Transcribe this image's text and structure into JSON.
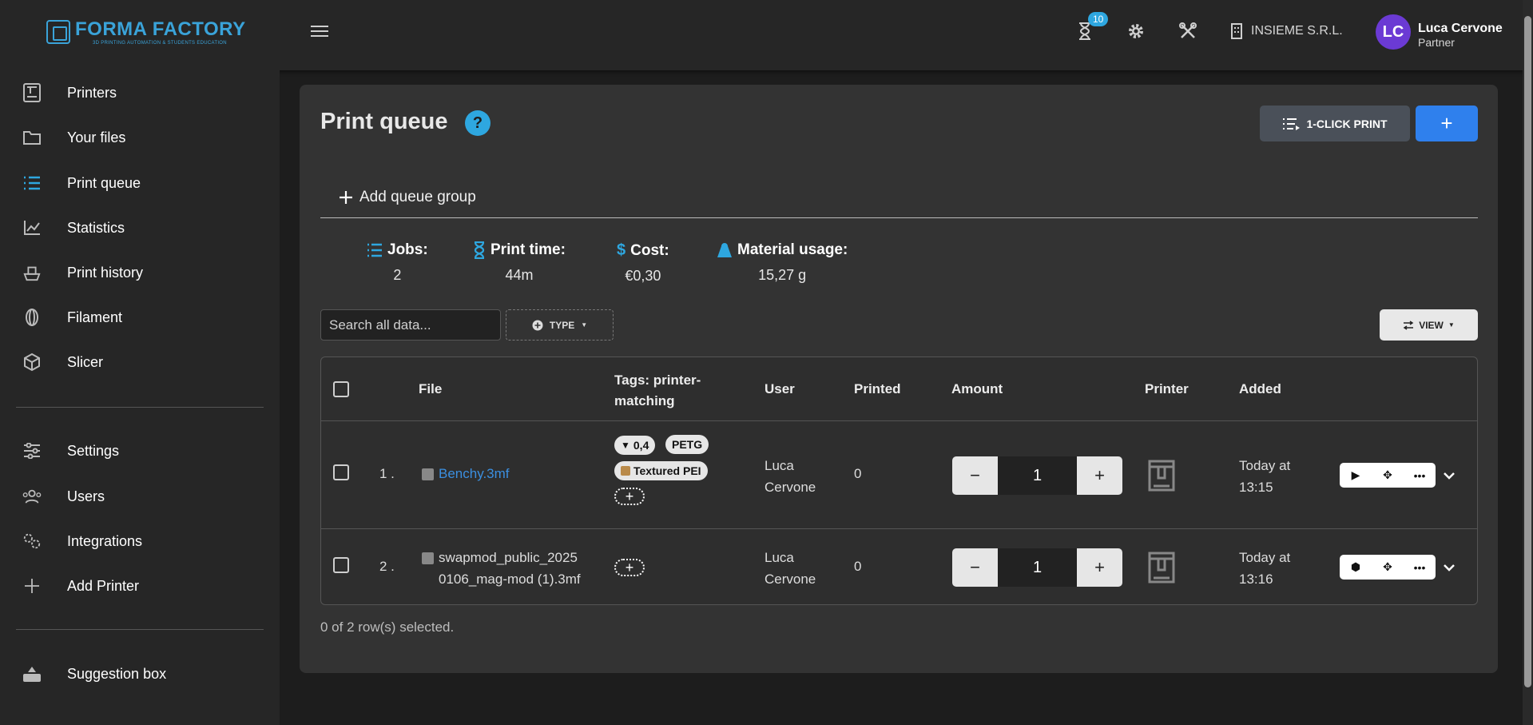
{
  "header": {
    "logo_title": "FORMA FACTORY",
    "logo_subtitle": "3D PRINTING AUTOMATION & STUDENTS EDUCATION",
    "queue_badge": "10",
    "company": "INSIEME S.R.L.",
    "avatar_initials": "LC",
    "user_name": "Luca Cervone",
    "user_role": "Partner"
  },
  "sidebar": {
    "items": [
      {
        "label": "Printers",
        "icon": "printer-icon"
      },
      {
        "label": "Your files",
        "icon": "folder-icon"
      },
      {
        "label": "Print queue",
        "icon": "list-icon"
      },
      {
        "label": "Statistics",
        "icon": "chart-icon"
      },
      {
        "label": "Print history",
        "icon": "history-icon"
      },
      {
        "label": "Filament",
        "icon": "filament-icon"
      },
      {
        "label": "Slicer",
        "icon": "cube-icon"
      },
      {
        "label": "Settings",
        "icon": "sliders-icon"
      },
      {
        "label": "Users",
        "icon": "users-icon"
      },
      {
        "label": "Integrations",
        "icon": "gears-icon"
      },
      {
        "label": "Add Printer",
        "icon": "plus-icon"
      },
      {
        "label": "Suggestion box",
        "icon": "inbox-icon"
      }
    ],
    "active": "Print queue"
  },
  "main": {
    "title": "Print queue",
    "help": "?",
    "oneclick_label": "1-CLICK PRINT",
    "add_label": "+",
    "add_group_label": "Add queue group",
    "stats": {
      "jobs_label": "Jobs:",
      "jobs_value": "2",
      "time_label": "Print time:",
      "time_value": "44m",
      "cost_label": "Cost:",
      "cost_value": "€0,30",
      "material_label": "Material usage:",
      "material_value": "15,27 g"
    },
    "search_placeholder": "Search all data...",
    "type_label": "TYPE",
    "view_label": "VIEW",
    "columns": {
      "file": "File",
      "tags_line1": "Tags: printer-",
      "tags_line2": "matching",
      "user": "User",
      "printed": "Printed",
      "amount": "Amount",
      "printer": "Printer",
      "added": "Added"
    },
    "rows": [
      {
        "index": "1 .",
        "file": "Benchy.3mf",
        "tag_nozzle": "0,4",
        "tag_material": "PETG",
        "tag_plate": "Textured PEI",
        "user_line1": "Luca",
        "user_line2": "Cervone",
        "printed": "0",
        "amount": "1",
        "added_line1": "Today at",
        "added_line2": "13:15"
      },
      {
        "index": "2 .",
        "file_line1": "swapmod_public_2025",
        "file_line2": "0106_mag-mod (1).3mf",
        "user_line1": "Luca",
        "user_line2": "Cervone",
        "printed": "0",
        "amount": "1",
        "added_line1": "Today at",
        "added_line2": "13:16"
      }
    ],
    "selection_note": "0 of 2 row(s) selected."
  },
  "colors": {
    "accent": "#2ea7e0",
    "primary_button": "#2f80ed",
    "avatar": "#6b3ad4"
  }
}
